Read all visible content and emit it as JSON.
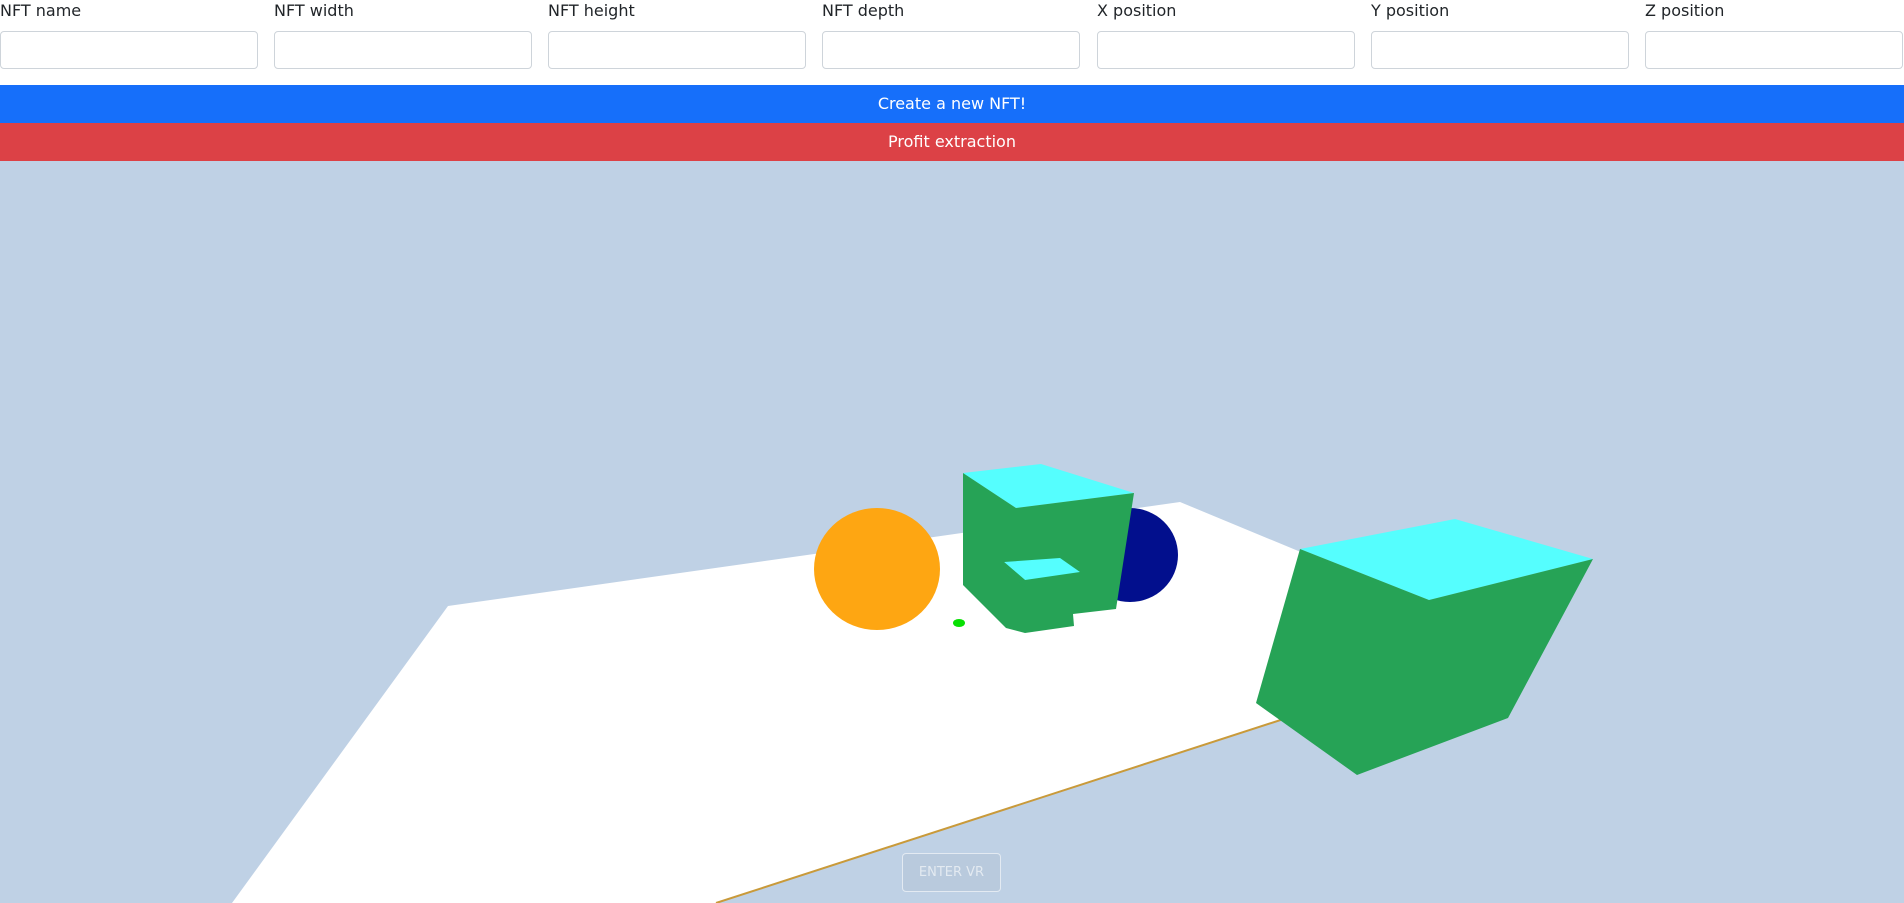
{
  "form": {
    "fields": [
      {
        "label": "NFT name",
        "value": "",
        "placeholder": ""
      },
      {
        "label": "NFT width",
        "value": "",
        "placeholder": ""
      },
      {
        "label": "NFT height",
        "value": "",
        "placeholder": ""
      },
      {
        "label": "NFT depth",
        "value": "",
        "placeholder": ""
      },
      {
        "label": "X position",
        "value": "",
        "placeholder": ""
      },
      {
        "label": "Y position",
        "value": "",
        "placeholder": ""
      },
      {
        "label": "Z position",
        "value": "",
        "placeholder": ""
      }
    ]
  },
  "actions": {
    "create_label": "Create a new NFT!",
    "profit_label": "Profit extraction"
  },
  "scene": {
    "vr_label": "ENTER VR",
    "colors": {
      "sky": "#bfd1e5",
      "ground": "#ffffff",
      "sphere_orange": "#fea612",
      "sphere_navy": "#020f8d",
      "cube_side": "#26a356",
      "cube_top": "#55fefe",
      "tiny_green": "#08e003",
      "edge_line": "#c99a3a"
    }
  }
}
